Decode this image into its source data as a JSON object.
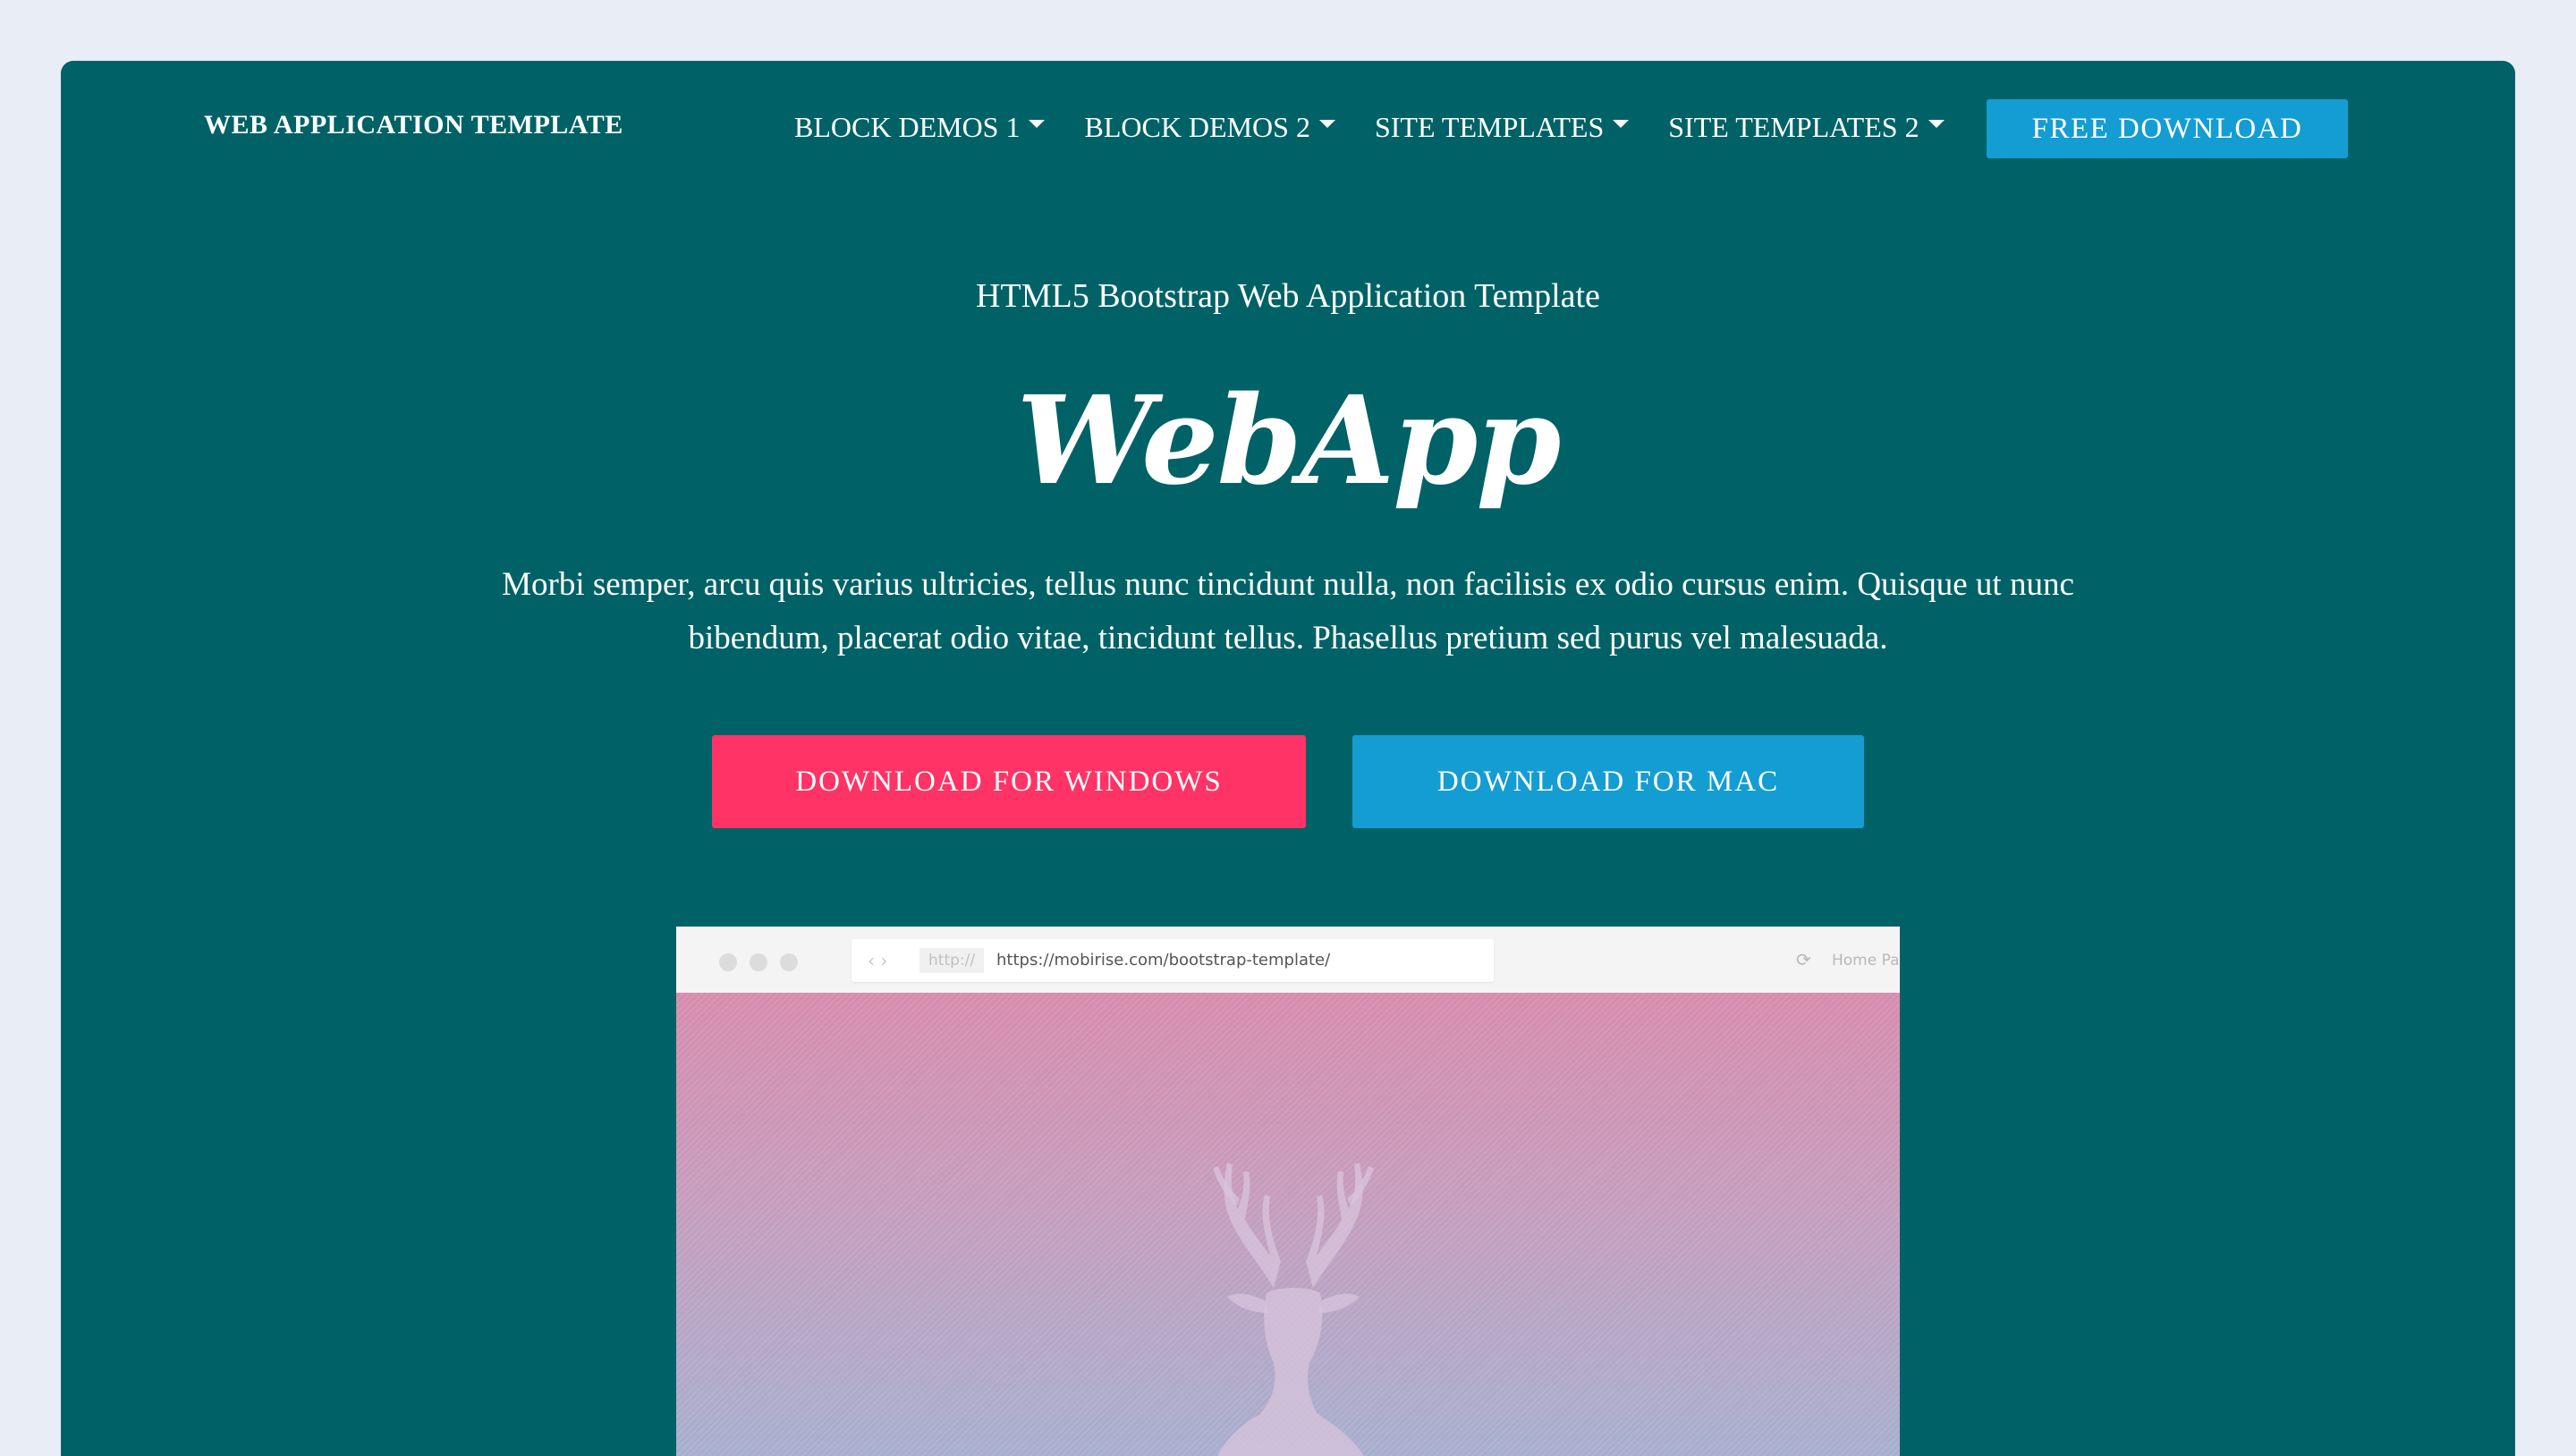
{
  "navbar": {
    "brand": "WEB APPLICATION TEMPLATE",
    "items": [
      {
        "label": "BLOCK DEMOS 1"
      },
      {
        "label": "BLOCK DEMOS 2"
      },
      {
        "label": "SITE TEMPLATES"
      },
      {
        "label": "SITE TEMPLATES 2"
      }
    ],
    "cta_label": "FREE DOWNLOAD"
  },
  "hero": {
    "subtitle": "HTML5 Bootstrap Web Application Template",
    "title": "WebApp",
    "lead_line1": "Morbi semper, arcu quis varius ultricies, tellus nunc tincidunt nulla, non facilisis ex odio cursus enim. Quisque ut nunc",
    "lead_line2": "bibendum, placerat odio vitae, tincidunt tellus. Phasellus pretium sed purus vel malesuada.",
    "btn_windows": "DOWNLOAD FOR WINDOWS",
    "btn_mac": "DOWNLOAD FOR MAC"
  },
  "mockup": {
    "protocol": "http://",
    "url": "https://mobirise.com/bootstrap-template/",
    "home_label": "Home Page",
    "icons": [
      "chevron-left-icon",
      "chevron-right-icon",
      "reload-icon",
      "deer-icon"
    ]
  },
  "colors": {
    "frame_bg": "#006266",
    "page_bg": "#e8edf6",
    "primary_blue": "#149dd3",
    "accent_pink": "#ff3366"
  }
}
